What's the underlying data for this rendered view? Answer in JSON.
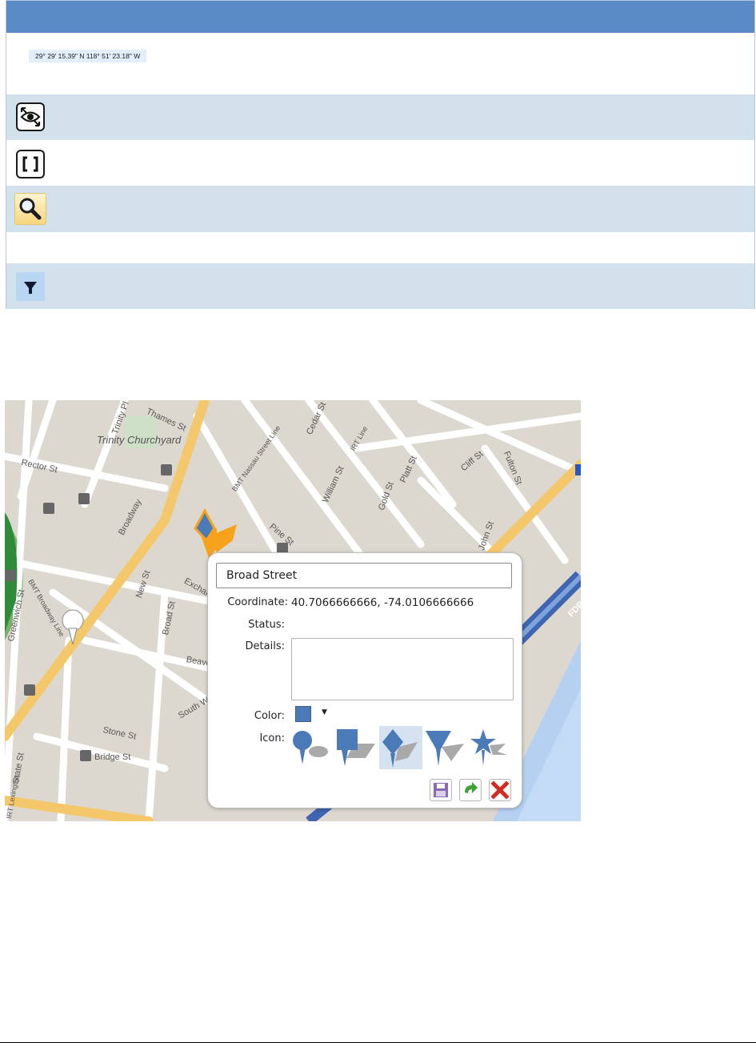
{
  "coordinate_display": "29° 29' 15.39\" N 118° 51' 23.18\" W",
  "table_icons": [
    "eye-arrow-icon",
    "brackets-icon",
    "magnifier-icon",
    "filter-icon"
  ],
  "map": {
    "area_label": "Trinity Churchyard",
    "street_labels": [
      "Trinity Pl",
      "Thames St",
      "Rector St",
      "Broadway",
      "BMT Nassau Street Line",
      "Cedar St",
      "William St",
      "IRT Line",
      "Gold St",
      "Platt St",
      "Pine St",
      "New St",
      "Exchange",
      "Broad St",
      "BMT Broadway Line",
      "Beaver St",
      "South William St",
      "Stone St",
      "Bridge St",
      "State St",
      "Cliff St",
      "Fulton St",
      "John St",
      "Greenwich St",
      "FDR",
      "IRT Lexington"
    ]
  },
  "popup": {
    "title_value": "Broad Street",
    "coordinate_label": "Coordinate:",
    "coordinate_value": "40.7066666666, -74.0106666666",
    "status_label": "Status:",
    "status_value": "",
    "details_label": "Details:",
    "details_value": "",
    "color_label": "Color:",
    "color_value": "#4a7ab8",
    "icon_label": "Icon:",
    "icon_options": [
      "circle-pin-icon",
      "square-pin-icon",
      "diamond-pin-icon",
      "triangle-pin-icon",
      "star-pin-icon"
    ],
    "selected_icon": "diamond-pin-icon",
    "buttons": [
      "save-icon",
      "redo-icon",
      "delete-icon"
    ]
  },
  "colors": {
    "header": "#5b8bc6",
    "row_alt": "#d3e1ec",
    "marker_orange": "#f7a21b",
    "marker_blue": "#4a7ab8"
  }
}
